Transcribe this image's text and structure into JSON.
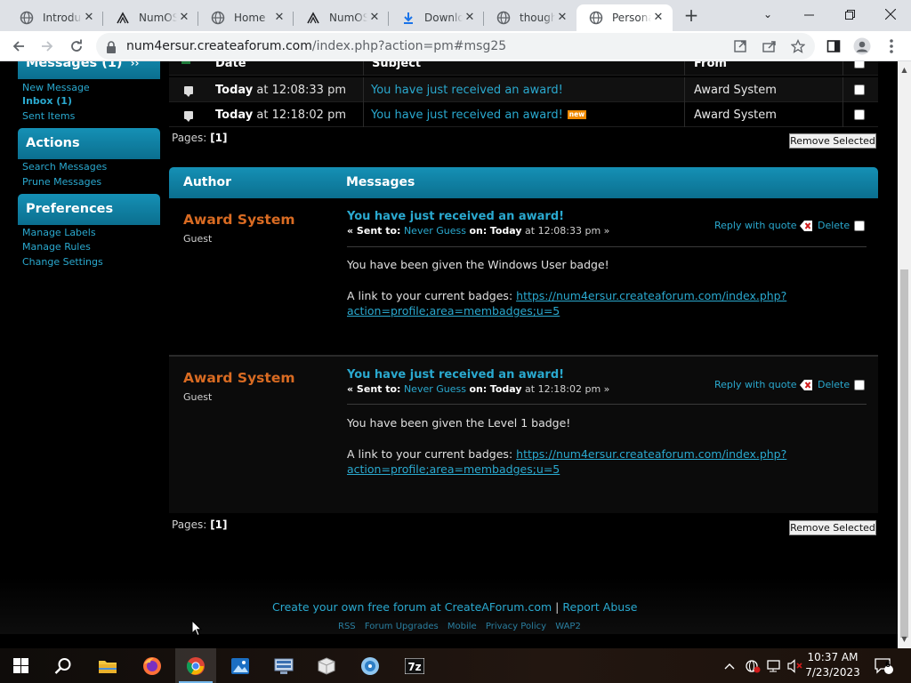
{
  "browser": {
    "tabs": [
      {
        "label": "Introdu",
        "icon": "globe-icon"
      },
      {
        "label": "NumOS",
        "icon": "forum-icon"
      },
      {
        "label": "Home",
        "icon": "globe-icon"
      },
      {
        "label": "NumOS",
        "icon": "forum-icon"
      },
      {
        "label": "Downlo",
        "icon": "download-icon"
      },
      {
        "label": "though",
        "icon": "globe-icon"
      },
      {
        "label": "Persona",
        "icon": "globe-icon"
      }
    ],
    "url_domain": "num4ersur.createaforum.com",
    "url_path": "/index.php?action=pm#msg25"
  },
  "sidebar": {
    "messages_header": "Messages (1)",
    "messages_links": [
      "New Message",
      "Inbox (1)",
      "Sent Items"
    ],
    "actions_header": "Actions",
    "actions_links": [
      "Search Messages",
      "Prune Messages"
    ],
    "preferences_header": "Preferences",
    "preferences_links": [
      "Manage Labels",
      "Manage Rules",
      "Change Settings"
    ]
  },
  "message_list": {
    "headers": {
      "date": "Date",
      "subject": "Subject",
      "from": "From"
    },
    "rows": [
      {
        "date_bold": "Today",
        "date_rest": " at 12:08:33 pm",
        "subject": "You have just received an award!",
        "from": "Award System",
        "new": false
      },
      {
        "date_bold": "Today",
        "date_rest": " at 12:18:02 pm",
        "subject": "You have just received an award!",
        "from": "Award System",
        "new": true,
        "new_label": "new"
      }
    ],
    "pages_label": "Pages:",
    "pages_value": "[1]",
    "remove_label": "Remove Selected"
  },
  "messages": {
    "author_header": "Author",
    "messages_header": "Messages",
    "items": [
      {
        "author": "Award System",
        "role": "Guest",
        "subject": "You have just received an award!",
        "sent_prefix": "« Sent to:",
        "sent_to": "Never Guess",
        "sent_on_label": "on:",
        "sent_on_bold": "Today",
        "sent_on_rest": "at 12:08:33 pm »",
        "reply_label": "Reply with quote",
        "delete_label": "Delete",
        "body": "You have been given the Windows User badge!",
        "link_prefix": "A link to your current badges:",
        "link_line1": "https://num4ersur.createaforum.com/index.php?",
        "link_line2": "action=profile;area=membadges;u=5"
      },
      {
        "author": "Award System",
        "role": "Guest",
        "subject": "You have just received an award!",
        "sent_prefix": "« Sent to:",
        "sent_to": "Never Guess",
        "sent_on_label": "on:",
        "sent_on_bold": "Today",
        "sent_on_rest": "at 12:18:02 pm »",
        "reply_label": "Reply with quote",
        "delete_label": "Delete",
        "body": "You have been given the Level 1 badge!",
        "link_prefix": "A link to your current badges:",
        "link_line1": "https://num4ersur.createaforum.com/index.php?",
        "link_line2": "action=profile;area=membadges;u=5"
      }
    ],
    "pages_label": "Pages:",
    "pages_value": "[1]",
    "remove_label": "Remove Selected"
  },
  "footer": {
    "create_link": "Create your own free forum at CreateAForum.com",
    "separator": "|",
    "report_link": "Report Abuse",
    "links": [
      "RSS",
      "Forum Upgrades",
      "Mobile",
      "Privacy Policy",
      "WAP2"
    ]
  },
  "taskbar": {
    "apps": [
      "start-icon",
      "search-icon",
      "file-explorer-icon",
      "firefox-icon",
      "chrome-icon",
      "photos-icon",
      "network-app-icon",
      "package-icon",
      "disc-app-icon",
      "7zip-icon"
    ],
    "time": "10:37 AM",
    "date": "7/23/2023",
    "notification_count": "6"
  },
  "colors": {
    "accent_header": "#1590b5",
    "link": "#2aa9cf",
    "author": "#d96b22",
    "new_badge": "#ef8a00"
  }
}
